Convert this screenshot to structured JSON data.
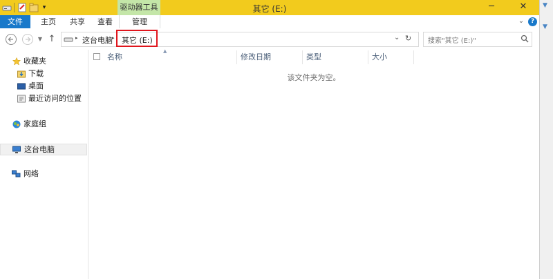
{
  "window": {
    "title": "其它 (E:)"
  },
  "ribbon": {
    "context_group": "驱动器工具",
    "tabs": [
      "文件",
      "主页",
      "共享",
      "查看",
      "管理"
    ]
  },
  "address": {
    "crumb_root": "这台电脑",
    "crumb_current": "其它 (E:)",
    "search_placeholder": "搜索\"其它 (E:)\""
  },
  "nav": {
    "favorites": "收藏夹",
    "downloads": "下载",
    "desktop": "桌面",
    "recent": "最近访问的位置",
    "homegroup": "家庭组",
    "this_pc": "这台电脑",
    "network": "网络"
  },
  "columns": [
    "名称",
    "修改日期",
    "类型",
    "大小"
  ],
  "empty_message": "该文件夹为空。",
  "colors": {
    "title_bar": "#f2cb1d",
    "file_tab": "#1979ca",
    "context_tab": "#c4e6a8",
    "highlight": "#e0161d"
  }
}
